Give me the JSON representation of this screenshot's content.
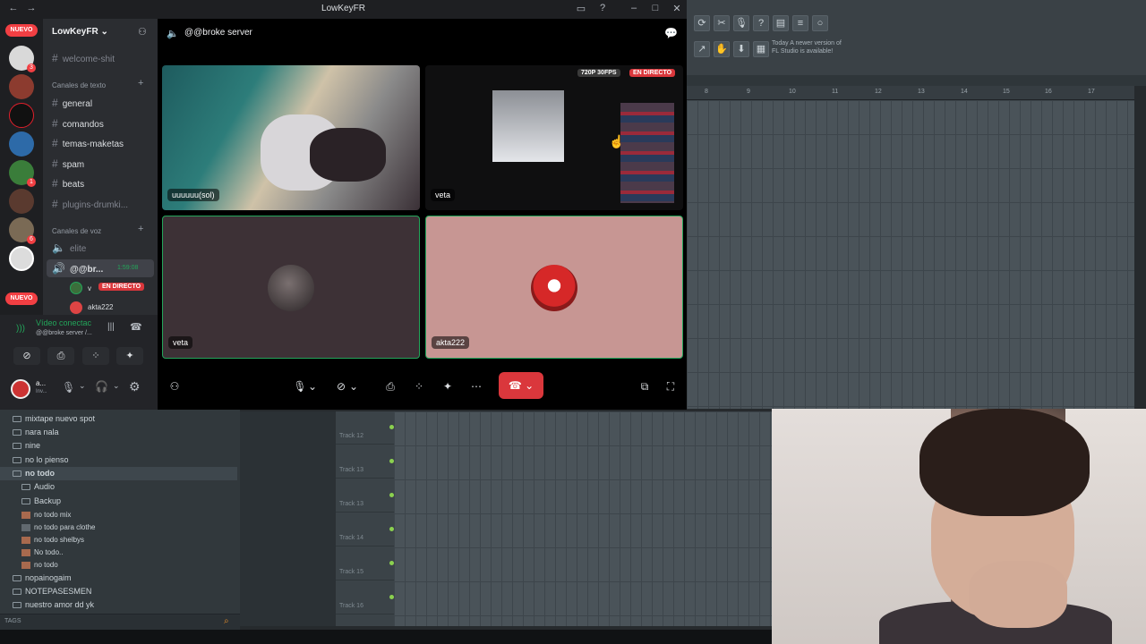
{
  "window": {
    "title": "LowKeyFR"
  },
  "servers": {
    "nuevo_top": "NUEVO",
    "nuevo_bottom": "NUEVO",
    "badges": [
      "3",
      "1",
      "6",
      "5"
    ]
  },
  "guild": {
    "name": "LowKeyFR",
    "channels_top": [
      {
        "name": "welcome-shit"
      }
    ],
    "text_category": "Canales de texto",
    "text_channels": [
      {
        "name": "general"
      },
      {
        "name": "comandos"
      },
      {
        "name": "temas-maketas"
      },
      {
        "name": "spam"
      },
      {
        "name": "beats"
      },
      {
        "name": "plugins-drumki..."
      }
    ],
    "voice_category": "Canales de voz",
    "voice_channels": [
      {
        "name": "elite"
      },
      {
        "name": "@@br...",
        "time": "1:59:08"
      }
    ],
    "voice_users": [
      {
        "name": "v",
        "badge": "EN DIRECTO"
      },
      {
        "name": "akta222"
      }
    ]
  },
  "voice_panel": {
    "status": "Vídeo conectac",
    "sub": "@@broke server /...",
    "user_initial": "a...",
    "user_sub": "Inv..."
  },
  "call": {
    "title": "@@broke server",
    "tiles": [
      {
        "label": "uuuuuu(sol)"
      },
      {
        "label": "veta",
        "quality": "720P 30FPS",
        "live": "EN DIRECTO"
      },
      {
        "label": "veta"
      },
      {
        "label": "akta222"
      }
    ]
  },
  "fl": {
    "hint_line1": "Today  A newer version of",
    "hint_line2": "FL Studio is available!",
    "ruler": [
      "8",
      "9",
      "10",
      "11",
      "12",
      "13",
      "14",
      "15",
      "16",
      "17"
    ],
    "tracks": [
      "Track 12",
      "Track 13",
      "Track 13",
      "Track 14",
      "Track 15",
      "Track 16"
    ],
    "browser": [
      {
        "label": "mixtape nuevo spot",
        "type": "folder"
      },
      {
        "label": "nara nala",
        "type": "folder"
      },
      {
        "label": "nine",
        "type": "folder"
      },
      {
        "label": "no lo pienso",
        "type": "folder"
      },
      {
        "label": "no todo",
        "type": "folder-open"
      },
      {
        "label": "Audio",
        "type": "sub-folder"
      },
      {
        "label": "Backup",
        "type": "sub-folder"
      },
      {
        "label": "no todo mix",
        "type": "file"
      },
      {
        "label": "no todo para clothe",
        "type": "file"
      },
      {
        "label": "no todo shelbys",
        "type": "file"
      },
      {
        "label": "No todo..",
        "type": "file"
      },
      {
        "label": "no todo",
        "type": "file"
      },
      {
        "label": "nopainogaim",
        "type": "folder"
      },
      {
        "label": "NOTEPASESMEN",
        "type": "folder"
      },
      {
        "label": "nuestro amor dd yk",
        "type": "folder"
      }
    ],
    "tags_label": "TAGS"
  },
  "colors": {
    "discord_bg": "#2b2d31",
    "live_red": "#da373c",
    "speaking_green": "#23a55a",
    "hangup_red": "#da373c"
  }
}
